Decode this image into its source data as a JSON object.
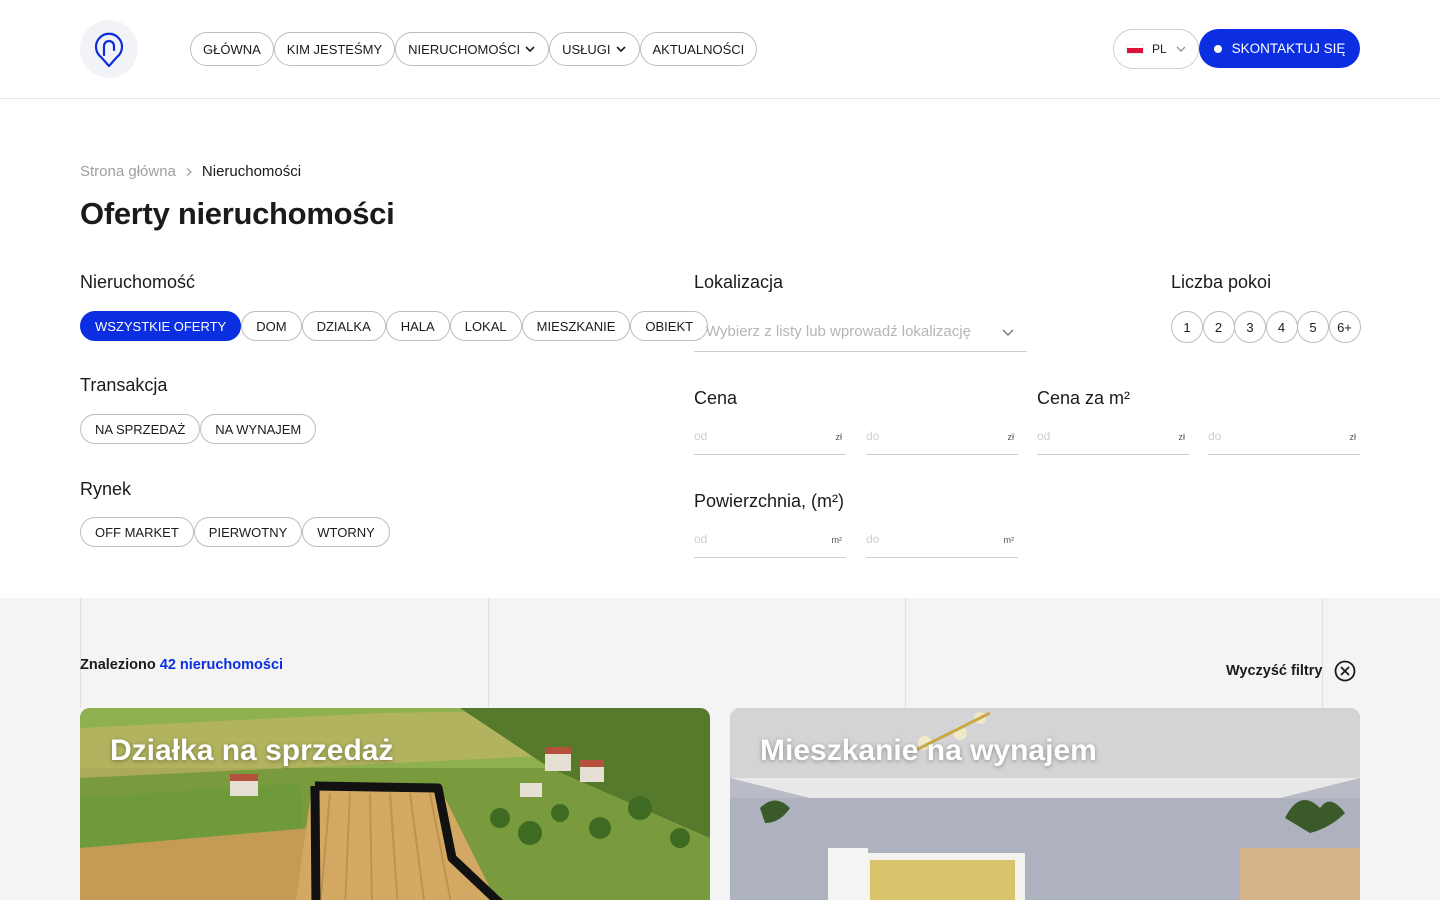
{
  "header": {
    "nav": [
      {
        "label": "GŁÓWNA",
        "has_dropdown": false
      },
      {
        "label": "KIM JESTEŚMY",
        "has_dropdown": false
      },
      {
        "label": "NIERUCHOMOŚCI",
        "has_dropdown": true
      },
      {
        "label": "USŁUGI",
        "has_dropdown": true
      },
      {
        "label": "AKTUALNOŚCI",
        "has_dropdown": false
      }
    ],
    "language": "PL",
    "cta_label": "SKONTAKTUJ SIĘ"
  },
  "breadcrumb": {
    "home": "Strona główna",
    "current": "Nieruchomości"
  },
  "page_title": "Oferty nieruchomości",
  "filters": {
    "property": {
      "label": "Nieruchomość",
      "options": [
        "WSZYSTKIE OFERTY",
        "DOM",
        "DZIALKA",
        "HALA",
        "LOKAL",
        "MIESZKANIE",
        "OBIEKT"
      ],
      "selected": "WSZYSTKIE OFERTY"
    },
    "transaction": {
      "label": "Transakcja",
      "options": [
        "NA SPRZEDAŻ",
        "NA WYNAJEM"
      ]
    },
    "market": {
      "label": "Rynek",
      "options": [
        "OFF MARKET",
        "PIERWOTNY",
        "WTORNY"
      ]
    },
    "location": {
      "label": "Lokalizacja",
      "placeholder": "Wybierz z listy lub wprowadź lokalizację"
    },
    "rooms": {
      "label": "Liczba pokoi",
      "options": [
        "1",
        "2",
        "3",
        "4",
        "5",
        "6+"
      ]
    },
    "price": {
      "label": "Cena",
      "from": "od",
      "to": "do",
      "unit": "zł"
    },
    "price_per_m2": {
      "label": "Cena za m²",
      "from": "od",
      "to": "do",
      "unit": "zł"
    },
    "area": {
      "label": "Powierzchnia, (m²)",
      "from": "od",
      "to": "do",
      "unit": "m²"
    }
  },
  "results": {
    "found_prefix": "Znaleziono",
    "found_count": "42 nieruchomości",
    "clear_label": "Wyczyść filtry",
    "cards": [
      {
        "title": "Działka na sprzedaż"
      },
      {
        "title": "Mieszkanie na wynajem"
      }
    ]
  },
  "colors": {
    "accent": "#0a2ee0",
    "text": "#1b1b1b",
    "muted": "#a0a0a0",
    "band_bg": "#f4f4f4"
  }
}
